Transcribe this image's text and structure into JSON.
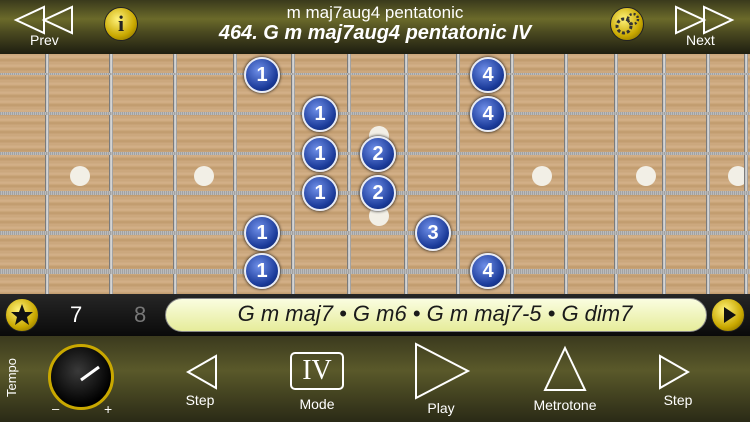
{
  "topbar": {
    "prev_label": "Prev",
    "next_label": "Next",
    "subtitle": "m maj7aug4 pentatonic",
    "title": "464. G m maj7aug4 pentatonic IV",
    "info_icon": "info-icon",
    "settings_icon": "gear-icon"
  },
  "fretboard": {
    "notes": [
      {
        "label": "1"
      },
      {
        "label": "4"
      },
      {
        "label": "1"
      },
      {
        "label": "4"
      },
      {
        "label": "1"
      },
      {
        "label": "2"
      },
      {
        "label": "1"
      },
      {
        "label": "2"
      },
      {
        "label": "1"
      },
      {
        "label": "3"
      },
      {
        "label": "1"
      },
      {
        "label": "4"
      }
    ]
  },
  "chordbar": {
    "favorite_icon": "star-icon",
    "position_current": "7",
    "position_next": "8",
    "chords_text": "G m maj7 • G m6 • G m maj7-5 • G dim7",
    "next_icon": "play-icon"
  },
  "bottombar": {
    "tempo_label": "Tempo",
    "tempo_minus": "–",
    "tempo_plus": "+",
    "step_back_label": "Step",
    "mode_label": "Mode",
    "mode_value": "IV",
    "play_label": "Play",
    "metrotone_label": "Metrotone",
    "step_forward_label": "Step"
  },
  "colors": {
    "note_fill": "#1b3b9a",
    "chord_pill": "#f3f7c4",
    "accent_gold": "#e8c800"
  }
}
